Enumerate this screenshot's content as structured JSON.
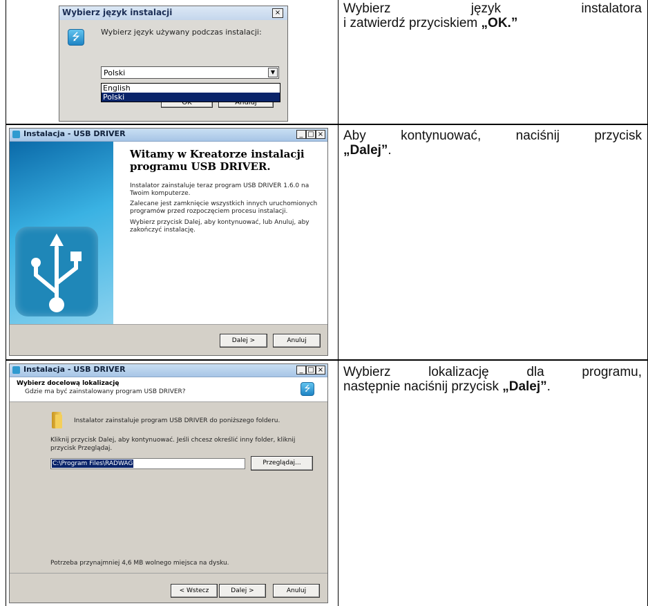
{
  "row1": {
    "dialog": {
      "title": "Wybierz język instalacji",
      "close": "×",
      "prompt": "Wybierz język używany podczas instalacji:",
      "selected": "Polski",
      "options": [
        "English",
        "Polski"
      ],
      "ok": "OK",
      "cancel": "Anuluj"
    },
    "instruction": {
      "line1": "Wybierz język instalatora",
      "line2_pre": "i zatwierdź przyciskiem ",
      "line2_bold": "„OK.”",
      "line2_post": "."
    }
  },
  "row2": {
    "window": {
      "title": "Instalacja - USB DRIVER",
      "heading": "Witamy w Kreatorze instalacji programu USB DRIVER.",
      "p1": "Instalator zainstaluje teraz program USB DRIVER 1.6.0 na Twoim komputerze.",
      "p2": "Zalecane jest zamknięcie wszystkich innych uruchomionych programów przed rozpoczęciem procesu instalacji.",
      "p3": "Wybierz przycisk Dalej, aby kontynuować, lub Anuluj, aby zakończyć instalację.",
      "next": "Dalej >",
      "cancel": "Anuluj"
    },
    "instruction": {
      "line1": "Aby kontynuować, naciśnij przycisk",
      "line2_bold": "„Dalej”",
      "line2_post": "."
    }
  },
  "row3": {
    "window": {
      "title": "Instalacja - USB DRIVER",
      "header_title": "Wybierz docelową lokalizację",
      "header_sub": "Gdzie ma być zainstalowany program USB DRIVER?",
      "info": "Instalator zainstaluje program USB DRIVER do poniższego folderu.",
      "hint": "Kliknij przycisk Dalej, aby kontynuować. Jeśli chcesz określić inny folder, kliknij przycisk Przeglądaj.",
      "path": "C:\\Program Files\\RADWAG",
      "browse": "Przeglądaj...",
      "space": "Potrzeba przynajmniej 4,6 MB wolnego miejsca na dysku.",
      "back": "< Wstecz",
      "next": "Dalej >",
      "cancel": "Anuluj"
    },
    "instruction": {
      "line1": "Wybierz lokalizację dla programu,",
      "line2_pre": "następnie naciśnij przycisk ",
      "line2_bold": "„Dalej”",
      "line2_post": "."
    }
  }
}
